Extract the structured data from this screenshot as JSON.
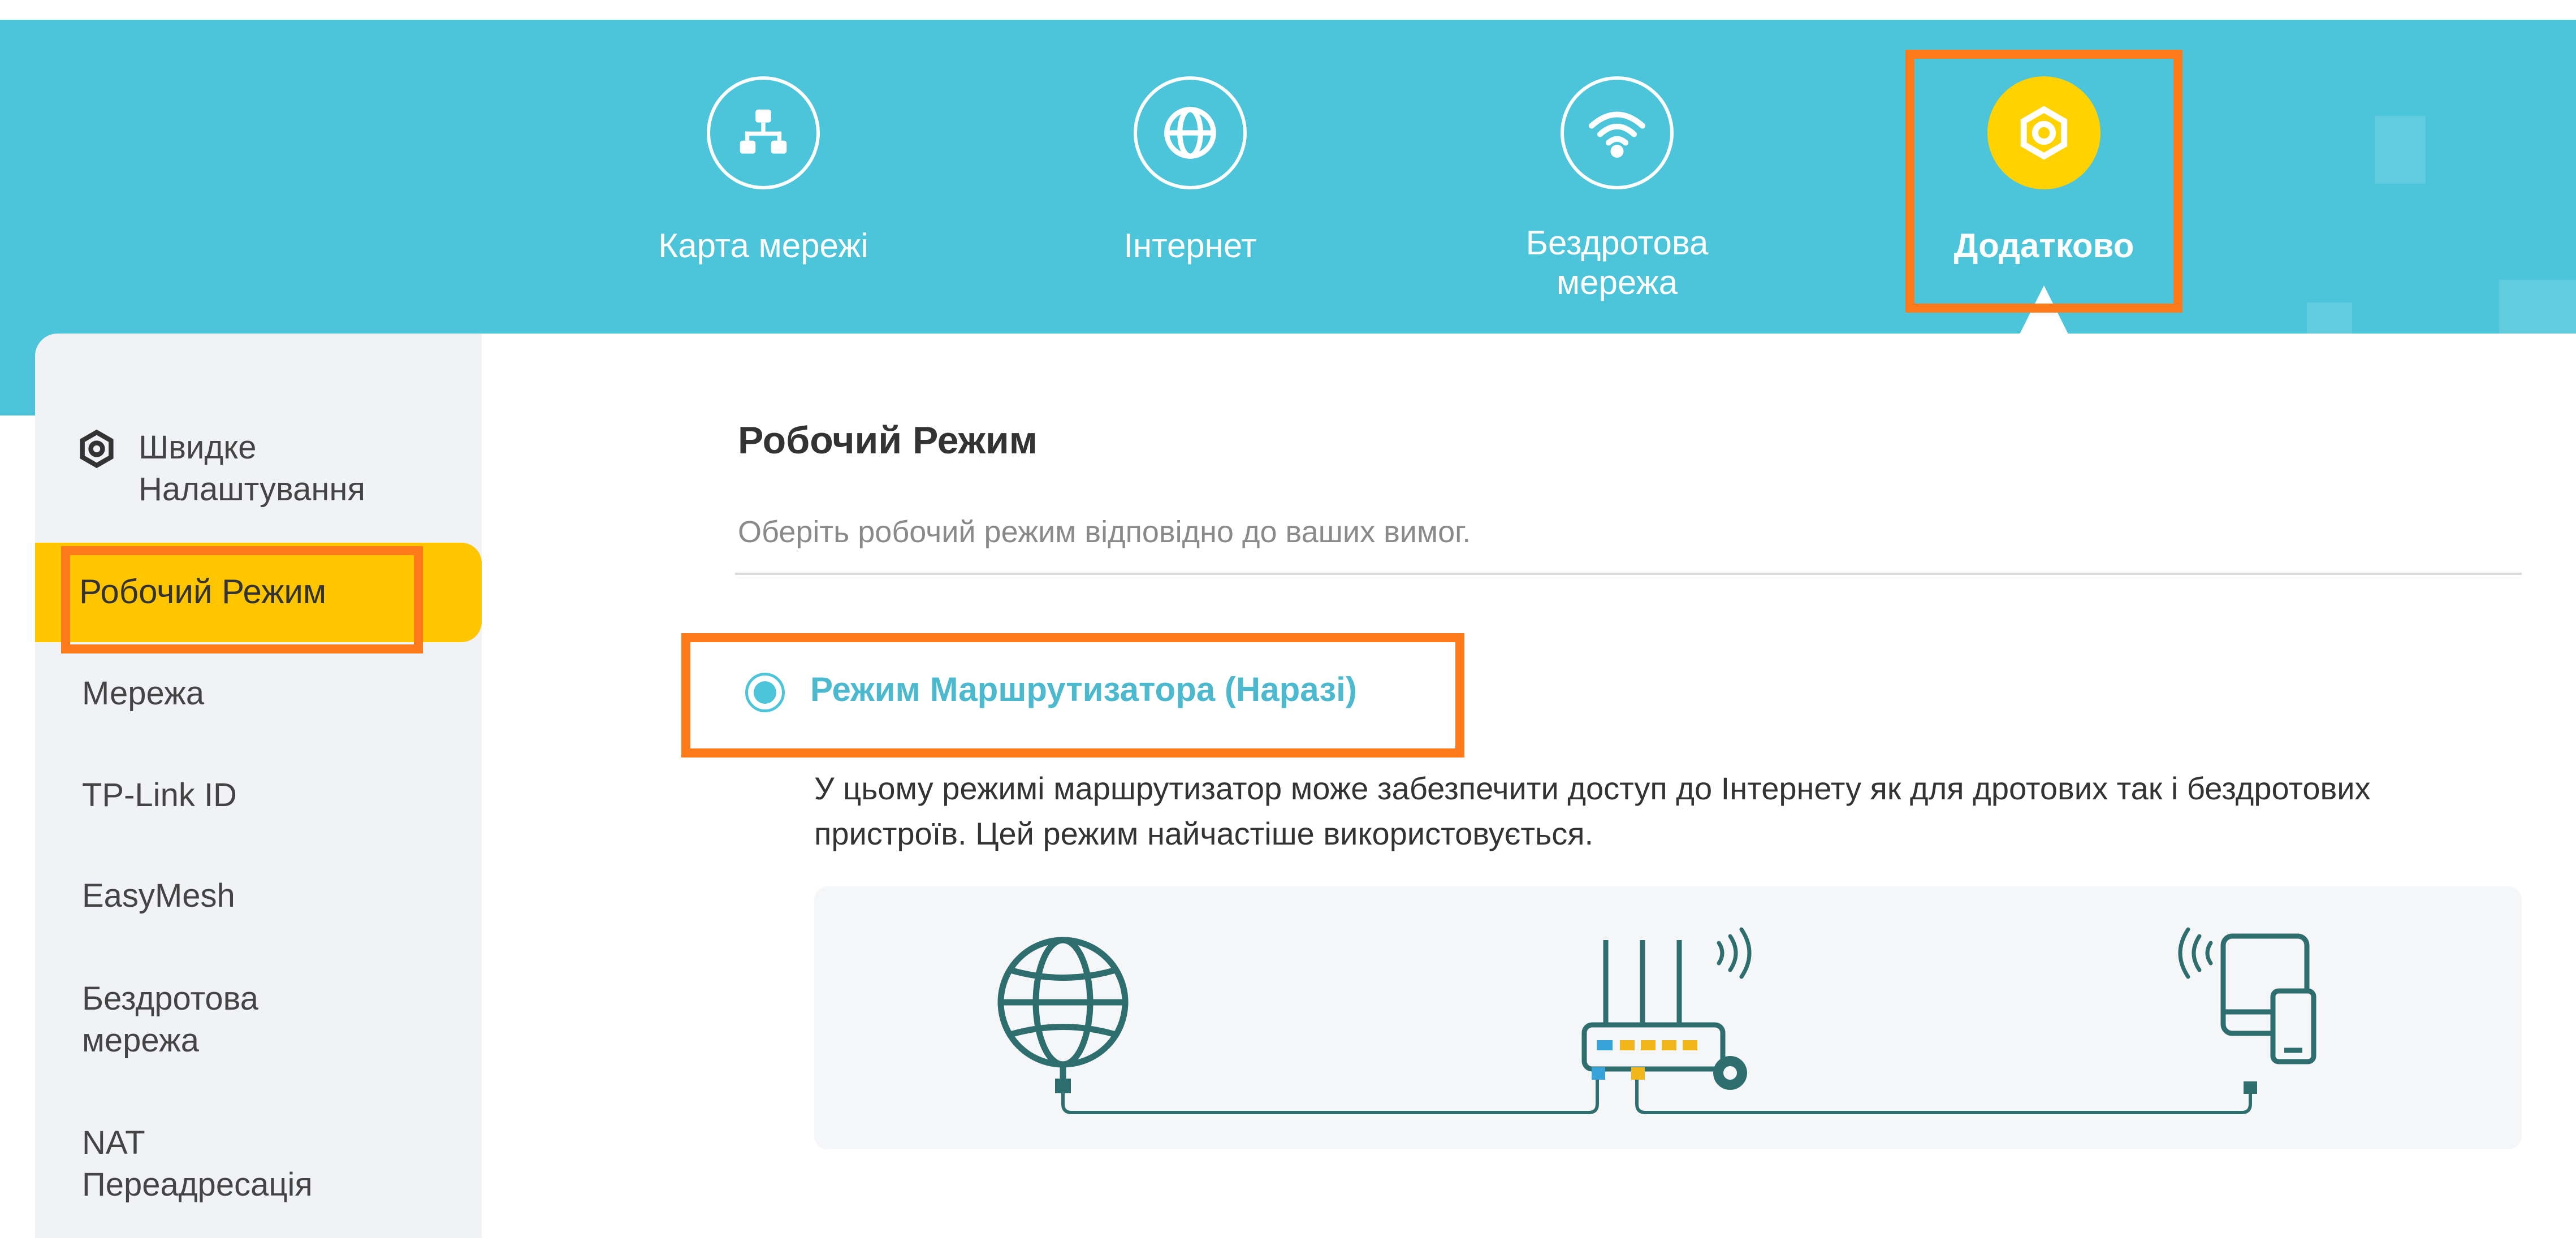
{
  "nav": {
    "items": [
      {
        "label": "Карта мережі",
        "icon": "network-map-icon"
      },
      {
        "label": "Інтернет",
        "icon": "globe-icon"
      },
      {
        "label": "Бездротова мережа",
        "icon": "wifi-icon"
      },
      {
        "label": "Додатково",
        "icon": "gear-icon",
        "active": true
      }
    ]
  },
  "sidebar": {
    "items": [
      {
        "label": "Швидке Налаштування",
        "icon": "gear-icon"
      },
      {
        "label": "Робочий Режим",
        "active": true
      },
      {
        "label": "Мережа"
      },
      {
        "label": "TP-Link ID"
      },
      {
        "label": "EasyMesh"
      },
      {
        "label": "Бездротова мережа"
      },
      {
        "label": "NAT Переадресація"
      }
    ]
  },
  "main": {
    "title": "Робочий Режим",
    "subtitle": "Оберіть робочий режим відповідно до ваших вимог.",
    "mode": {
      "label": "Режим Маршрутизатора (Наразі)",
      "selected": true,
      "description": "У цьому режимі маршрутизатор може забезпечити доступ до Інтернету як для дротових так і бездротових пристроїв. Цей режим найчастіше використовується."
    }
  },
  "colors": {
    "header": "#4cc5da",
    "active_nav": "#ffd200",
    "active_sidebar": "#ffc600",
    "highlight": "#ff7a1a",
    "accent_text": "#4cb9cf",
    "diagram_line": "#2f6e6e"
  }
}
